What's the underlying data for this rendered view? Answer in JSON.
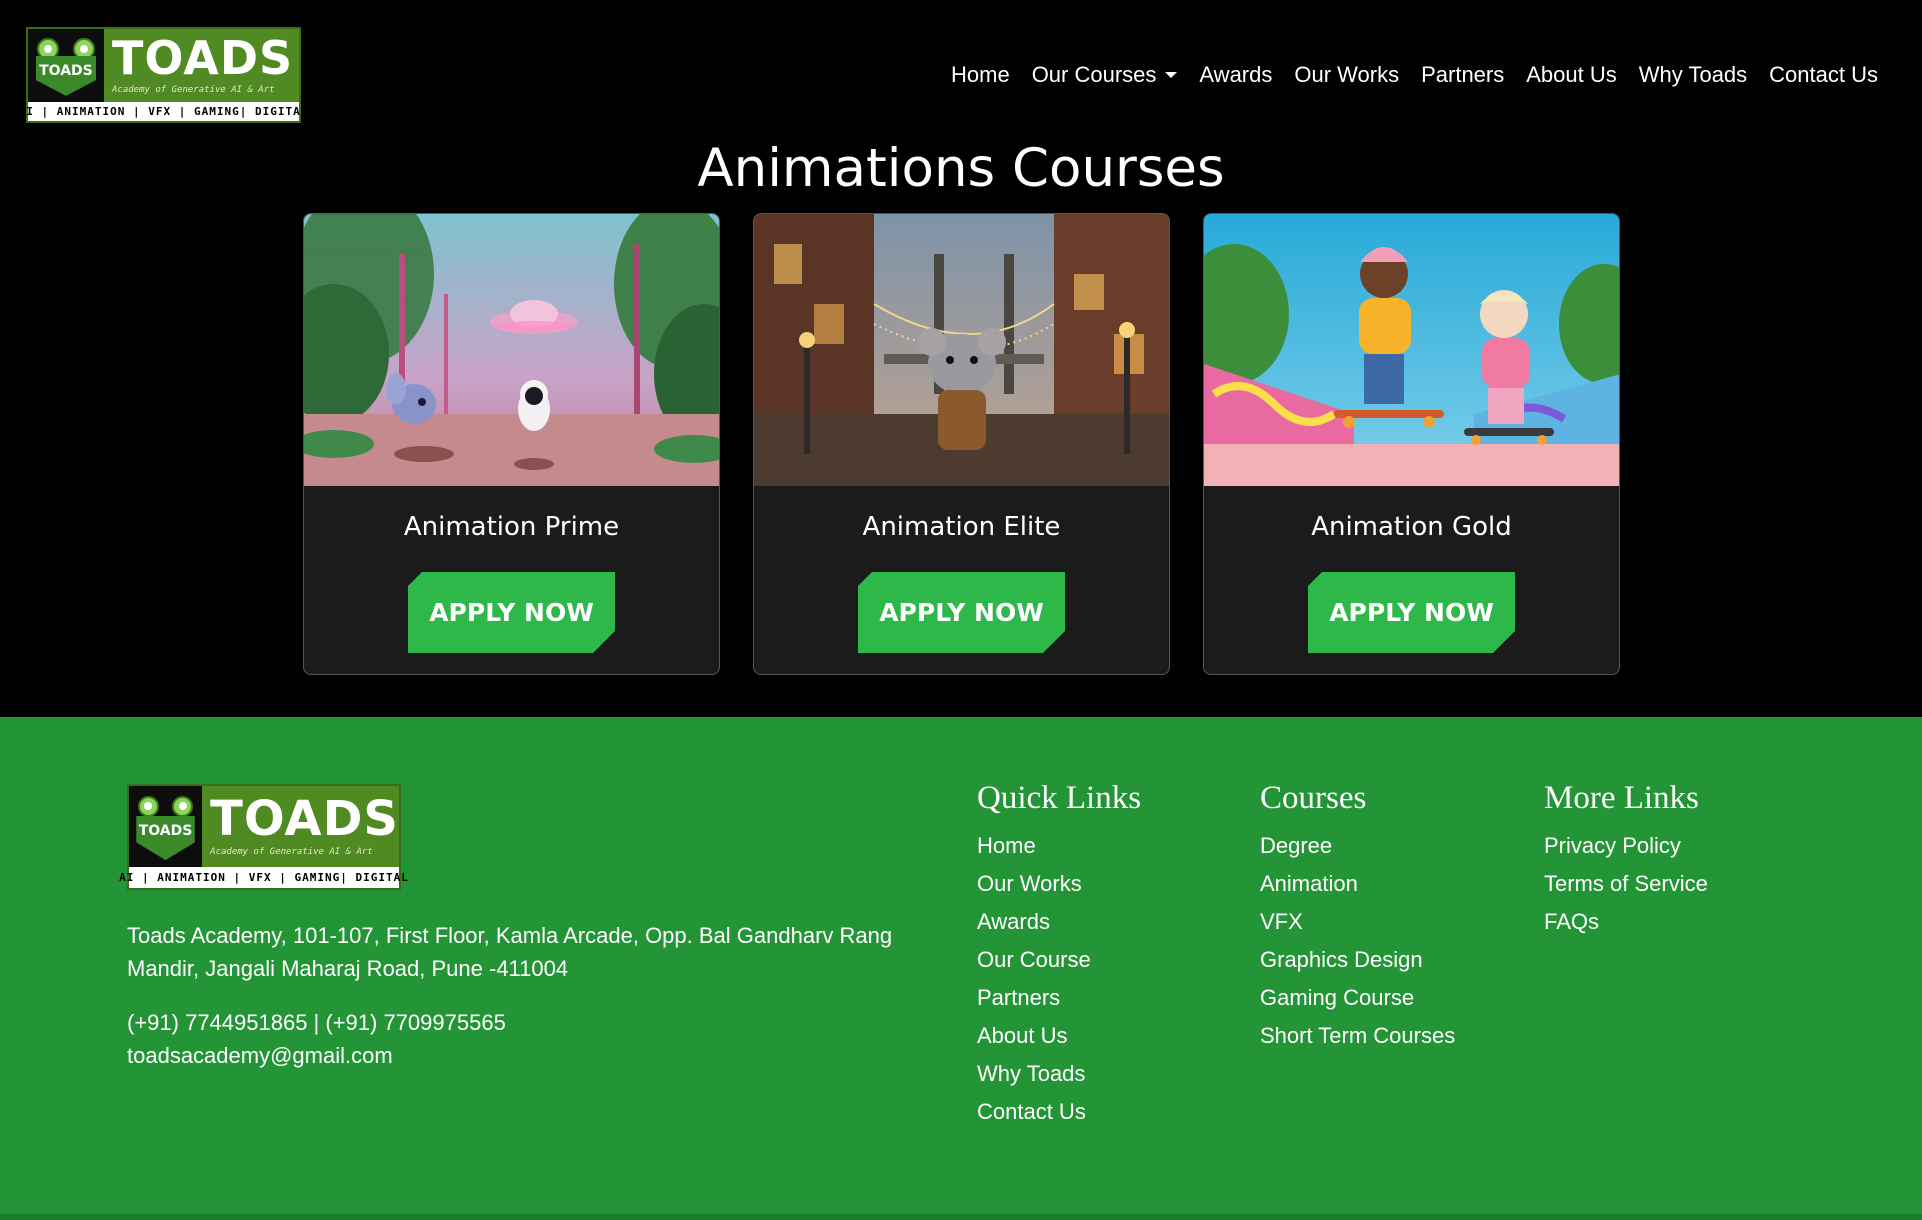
{
  "logo": {
    "name": "TOADS",
    "mascot_text": "TOADS",
    "subtitle": "Academy of Generative AI & Art",
    "tagline": "AI | ANIMATION | VFX | GAMING| DIGITAL"
  },
  "nav": {
    "items": [
      "Home",
      "Our Courses",
      "Awards",
      "Our Works",
      "Partners",
      "About Us",
      "Why Toads",
      "Contact Us"
    ]
  },
  "page_title": "Animations Courses",
  "cards": [
    {
      "title": "Animation Prime",
      "button": "APPLY NOW",
      "image": "alien-forest-ufo"
    },
    {
      "title": "Animation Elite",
      "button": "APPLY NOW",
      "image": "mouse-city-bridge"
    },
    {
      "title": "Animation Gold",
      "button": "APPLY NOW",
      "image": "kids-skateboarding"
    }
  ],
  "footer": {
    "address": "Toads Academy, 101-107, First Floor, Kamla Arcade, Opp. Bal Gandharv Rang Mandir, Jangali Maharaj Road, Pune -411004",
    "phones": "(+91) 7744951865 | (+91) 7709975565",
    "email": "toadsacademy@gmail.com",
    "quick_links": {
      "heading": "Quick Links",
      "items": [
        "Home",
        "Our Works",
        "Awards",
        "Our Course",
        "Partners",
        "About Us",
        "Why Toads",
        "Contact Us"
      ]
    },
    "courses": {
      "heading": "Courses",
      "items": [
        "Degree",
        "Animation",
        "VFX",
        "Graphics Design",
        "Gaming Course",
        "Short Term Courses"
      ]
    },
    "more_links": {
      "heading": "More Links",
      "items": [
        "Privacy Policy",
        "Terms of Service",
        "FAQs"
      ]
    }
  },
  "colors": {
    "brand_green": "#249536",
    "button_green": "#2fb84a",
    "logo_green": "#4f8a23",
    "card_bg": "#1b1b1b"
  }
}
